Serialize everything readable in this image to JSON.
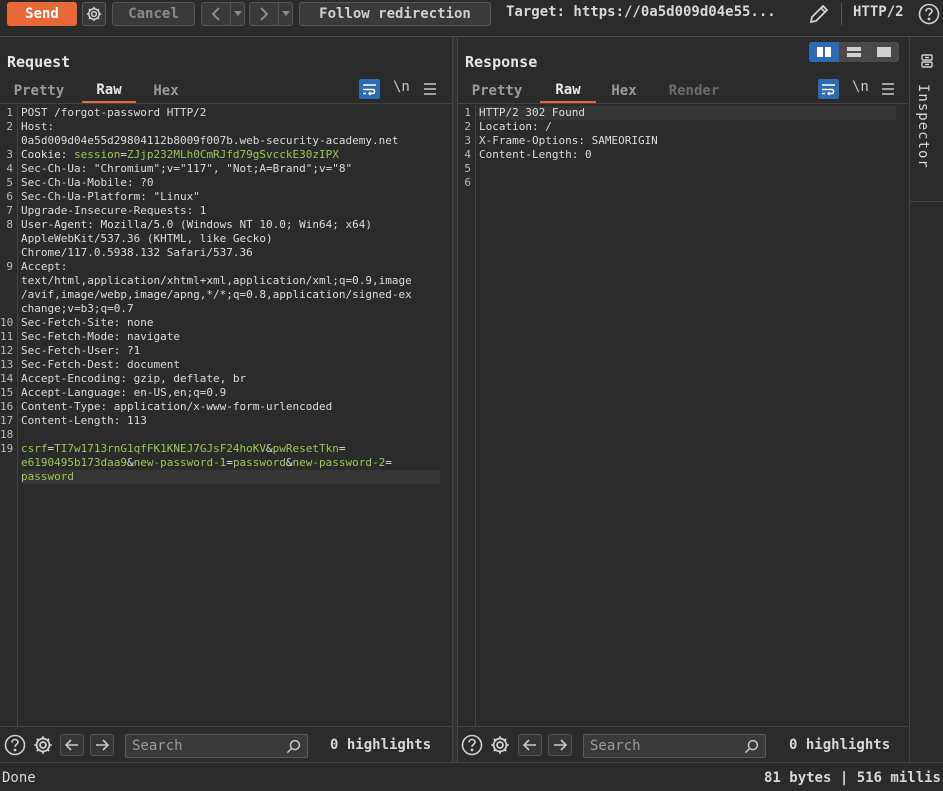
{
  "toolbar": {
    "send_label": "Send",
    "cancel_label": "Cancel",
    "back_glyph": "<",
    "forward_glyph": ">",
    "dropdown_glyph": "▾",
    "follow_label": "Follow redirection",
    "target": "Target: https://0a5d009d04e55...",
    "protocol": "HTTP/2"
  },
  "request": {
    "title": "Request",
    "tabs": [
      "Pretty",
      "Raw",
      "Hex"
    ],
    "active_tab": "Raw",
    "newline_label": "\\n",
    "line_numbers": [
      "1",
      "2",
      "",
      "3",
      "4",
      "5",
      "6",
      "7",
      "8",
      "",
      "",
      "9",
      "",
      "",
      "",
      "10",
      "11",
      "12",
      "13",
      "14",
      "15",
      "16",
      "17",
      "18",
      "19",
      "",
      ""
    ],
    "lines": {
      "l1": "POST /forgot-password HTTP/2",
      "l2": "Host:",
      "l2b": "0a5d009d04e55d29804112b8009f007b.web-security-academy.net",
      "l3k": "Cookie: ",
      "l3n": "session",
      "l3eq": "=",
      "l3v": "ZJjp232MLh0CmRJfd79gSvcckE30zIPX",
      "l4": "Sec-Ch-Ua: \"Chromium\";v=\"117\", \"Not;A=Brand\";v=\"8\"",
      "l5": "Sec-Ch-Ua-Mobile: ?0",
      "l6": "Sec-Ch-Ua-Platform: \"Linux\"",
      "l7": "Upgrade-Insecure-Requests: 1",
      "l8a": "User-Agent: Mozilla/5.0 (Windows NT 10.0; Win64; x64)",
      "l8b": "AppleWebKit/537.36 (KHTML, like Gecko)",
      "l8c": "Chrome/117.0.5938.132 Safari/537.36",
      "l9": "Accept:",
      "l9a": "text/html,application/xhtml+xml,application/xml;q=0.9,image",
      "l9b": "/avif,image/webp,image/apng,*/*;q=0.8,application/signed-ex",
      "l9c": "change;v=b3;q=0.7",
      "l10": "Sec-Fetch-Site: none",
      "l11": "Sec-Fetch-Mode: navigate",
      "l12": "Sec-Fetch-User: ?1",
      "l13": "Sec-Fetch-Dest: document",
      "l14": "Accept-Encoding: gzip, deflate, br",
      "l15": "Accept-Language: en-US,en;q=0.9",
      "l16": "Content-Type: application/x-www-form-urlencoded",
      "l17": "Content-Length: 113",
      "b1": "csrf",
      "b2": "=",
      "b3": "TI7w1713rnG1qfFK1KNEJ7GJsF24hoKV",
      "b4": "&",
      "b5": "pwResetTkn",
      "b6": "=",
      "b7": "e6190495b173daa9",
      "b8": "&",
      "b9": "new-password-1",
      "b10": "=",
      "b11": "password",
      "b12": "&",
      "b13": "new-password-2",
      "b14": "=",
      "b15": "password"
    },
    "search_placeholder": "Search",
    "highlights": "0 highlights"
  },
  "response": {
    "title": "Response",
    "tabs": [
      "Pretty",
      "Raw",
      "Hex",
      "Render"
    ],
    "active_tab": "Raw",
    "newline_label": "\\n",
    "line_numbers": [
      "1",
      "2",
      "3",
      "4",
      "5",
      "6"
    ],
    "lines": {
      "l1": "HTTP/2 302 Found",
      "l2": "Location: /",
      "l3": "X-Frame-Options: SAMEORIGIN",
      "l4": "Content-Length: 0"
    },
    "search_placeholder": "Search",
    "highlights": "0 highlights"
  },
  "inspector": {
    "label": "Inspector"
  },
  "status": {
    "left": "Done",
    "right": "81 bytes | 516 millis"
  }
}
